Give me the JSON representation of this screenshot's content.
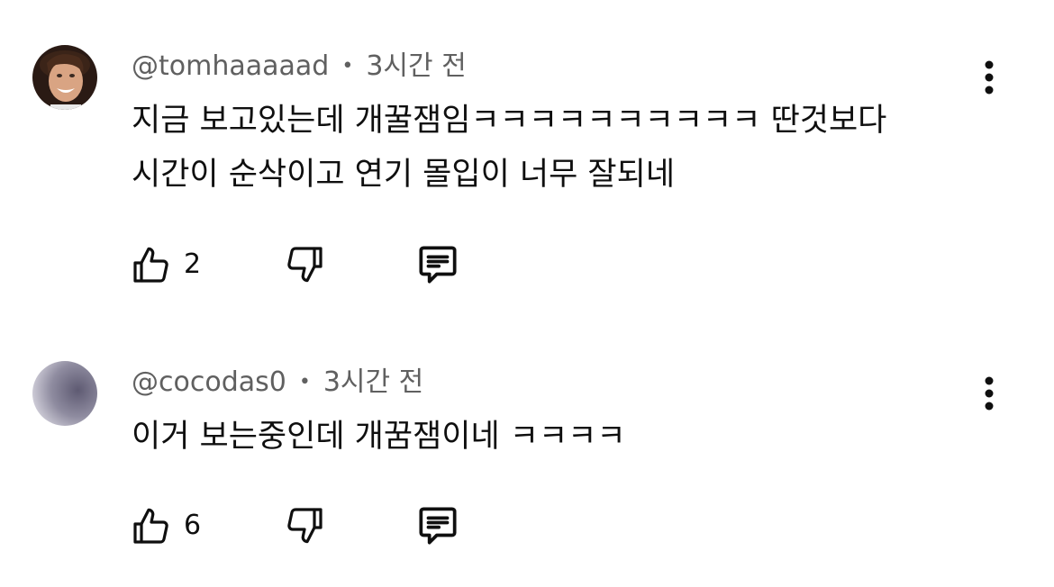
{
  "comments": [
    {
      "handle": "@tomhaaaaad",
      "separator": "•",
      "time": "3시간 전",
      "lines": [
        "지금 보고있는데 개꿀잼임ㅋㅋㅋㅋㅋㅋㅋㅋㅋㅋ 딴것보다",
        "시간이 순삭이고 연기 몰입이 너무 잘되네"
      ],
      "like_count": "2",
      "avatar": "photo"
    },
    {
      "handle": "@cocodas0",
      "separator": "•",
      "time": "3시간 전",
      "lines": [
        "이거 보는중인데 개꿈잼이네 ㅋㅋㅋㅋ"
      ],
      "like_count": "6",
      "avatar": "gradient"
    }
  ],
  "icons": {
    "like": "thumbs-up-icon",
    "dislike": "thumbs-down-icon",
    "reply": "reply-comment-icon",
    "more": "more-vertical-icon"
  },
  "colors": {
    "text": "#0f0f0f",
    "secondary": "#606060"
  }
}
